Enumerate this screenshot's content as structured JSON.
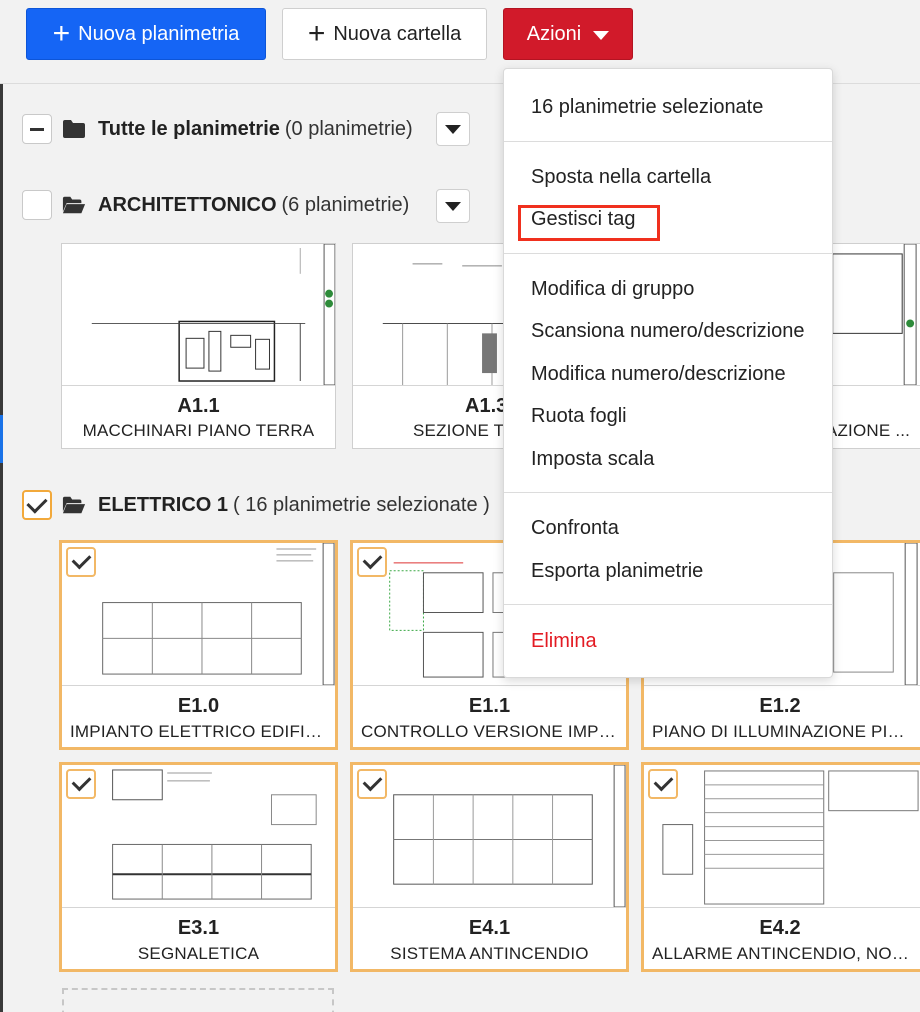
{
  "toolbar": {
    "new_plan_label": "Nuova planimetria",
    "new_folder_label": "Nuova cartella",
    "actions_label": "Azioni"
  },
  "groups": {
    "all": {
      "name": "Tutte le planimetrie",
      "count": "(0 planimetrie)"
    },
    "arch": {
      "name": "ARCHITETTONICO",
      "count": "(6 planimetrie)"
    },
    "elec": {
      "name": "ELETTRICO 1",
      "count": "( 16 planimetrie selezionate )"
    }
  },
  "arch_sheets": [
    {
      "number": "A1.1",
      "title": "MACCHINARI PIANO TERRA"
    },
    {
      "number": "A1.3",
      "title": "SEZIONE T"
    },
    {
      "number": "",
      "title": "AZIONE ..."
    }
  ],
  "elec_sheets": [
    {
      "number": "E1.0",
      "title": "IMPIANTO ELETTRICO EDIFICIO"
    },
    {
      "number": "E1.1",
      "title": "CONTROLLO VERSIONE IMPIANTO"
    },
    {
      "number": "E1.2",
      "title": "PIANO DI ILLUMINAZIONE PIANO"
    },
    {
      "number": "E3.1",
      "title": "SEGNALETICA"
    },
    {
      "number": "E4.1",
      "title": "SISTEMA ANTINCENDIO"
    },
    {
      "number": "E4.2",
      "title": "ALLARME ANTINCENDIO, NOTE"
    }
  ],
  "menu": {
    "selected_count": "16 planimetrie selezionate",
    "move_to_folder": "Sposta nella cartella",
    "manage_tags": "Gestisci tag",
    "group_edit": "Modifica di gruppo",
    "scan_number": "Scansiona numero/descrizione",
    "edit_number": "Modifica numero/descrizione",
    "rotate": "Ruota fogli",
    "set_scale": "Imposta scala",
    "compare": "Confronta",
    "export": "Esporta planimetrie",
    "delete": "Elimina"
  },
  "colors": {
    "primary": "#1565f5",
    "danger": "#d11a2a",
    "selection": "#f2b866",
    "highlight": "#f0301e"
  }
}
